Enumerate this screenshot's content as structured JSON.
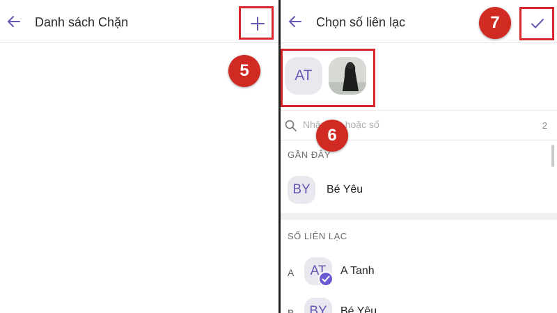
{
  "colors": {
    "accent": "#6657b5",
    "annotation": "#d9262c",
    "divider": "#1f1f1f"
  },
  "left_panel": {
    "title": "Danh sách Chặn",
    "back_icon": "arrow-left-icon",
    "add_icon": "plus-icon"
  },
  "right_panel": {
    "title": "Chọn số liên lạc",
    "back_icon": "arrow-left-icon",
    "confirm_icon": "check-icon",
    "selected": [
      {
        "initials": "AT"
      },
      {
        "type": "photo"
      }
    ],
    "search": {
      "placeholder": "Nhập tên hoặc số",
      "count": "2"
    },
    "recent": {
      "label": "GẦN ĐÂY",
      "items": [
        {
          "initials": "BY",
          "name": "Bé Yêu"
        }
      ]
    },
    "contacts": {
      "label": "SỐ LIÊN LẠC",
      "items": [
        {
          "letter": "A",
          "initials": "AT",
          "name": "A Tanh",
          "checked": true
        },
        {
          "letter": "B",
          "initials": "BY",
          "name": "Bé Yêu",
          "checked": false
        }
      ]
    }
  },
  "annotations": {
    "step5": "5",
    "step6": "6",
    "step7": "7"
  }
}
